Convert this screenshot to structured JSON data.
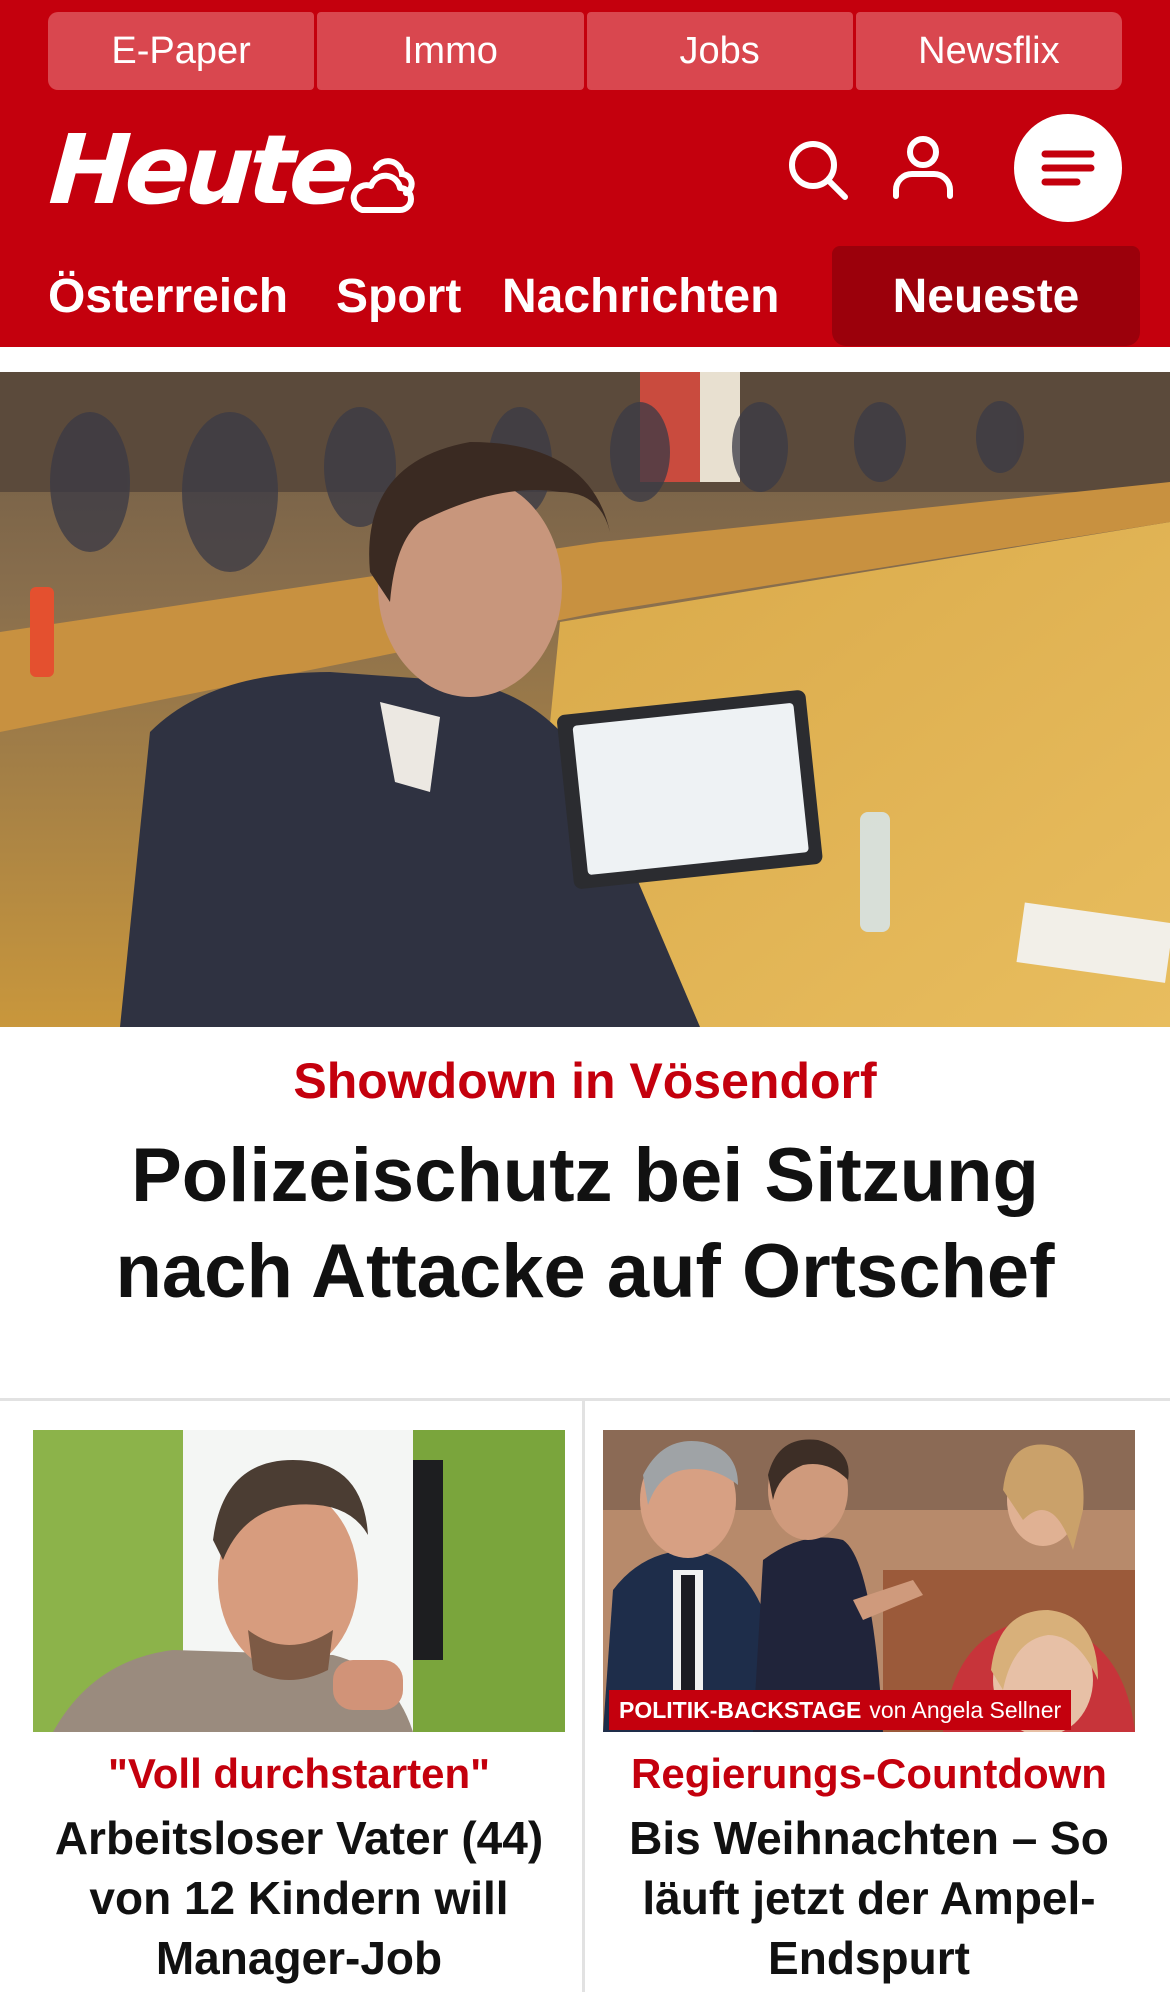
{
  "topbar": {
    "items": [
      "E-Paper",
      "Immo",
      "Jobs",
      "Newsflix"
    ]
  },
  "brand": {
    "logo_text": "Heute",
    "color_primary": "#c4000d",
    "color_nav_active": "#9b000b"
  },
  "icons": {
    "weather": "weather-cloud-icon",
    "search": "search-icon",
    "user": "user-icon",
    "menu": "menu-icon"
  },
  "nav": {
    "items": [
      "Österreich",
      "Sport",
      "Nachrichten"
    ],
    "active": "Neueste"
  },
  "hero": {
    "kicker": "Showdown in Vösendorf",
    "title": "Polizeischutz bei Sitzung nach Attacke auf Ortschef"
  },
  "cards": [
    {
      "kicker": "\"Voll durchstarten\"",
      "title": "Arbeitsloser Vater (44) von 12 Kindern will Manager-Job"
    },
    {
      "badge_bold": "POLITIK-BACKSTAGE",
      "badge_rest": "von Angela Sellner",
      "kicker": "Regierungs-Countdown",
      "title": "Bis Weihnachten – So läuft jetzt der Ampel-Endspurt"
    }
  ]
}
